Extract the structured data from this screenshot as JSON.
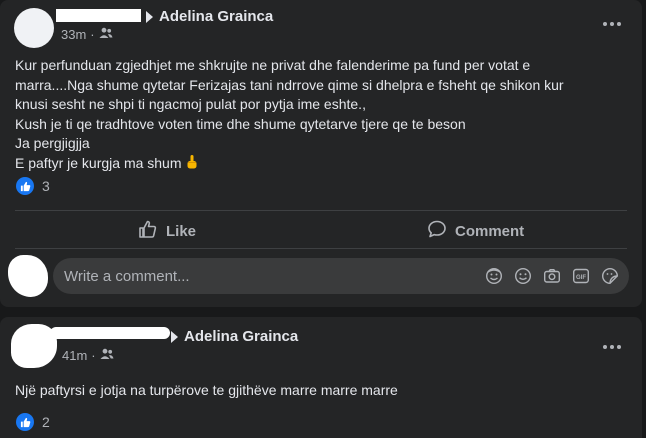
{
  "post1": {
    "author": "Adelina Grainca",
    "time": "33m",
    "text_lines": [
      "Kur perfunduan zgjedhjet me shkrujte ne privat dhe falenderime pa fund per votat e",
      "marra....Nga shume qytetar Ferizajas tani ndrrove qime si dhelpra e fsheht qe shikon kur",
      "knusi sesht ne shpi ti ngacmoj pulat por pytja ime eshte.,",
      "Kush je ti qe tradhtove voten time dhe shume qytetarve tjere qe te beson",
      "Ja pergjigjja",
      "E paftyr je kurgja ma shum"
    ],
    "reaction_count": "3",
    "like_label": "Like",
    "comment_label": "Comment",
    "comment_placeholder": "Write a comment...",
    "comment_icons": [
      "avatar-sticker-icon",
      "emoji-icon",
      "camera-icon",
      "gif-icon",
      "sticker-icon"
    ]
  },
  "post2": {
    "author": "Adelina Graincа",
    "time": "41m",
    "text": "Një paftyrsi e jotja na turpërove te gjithëve marre marre marre",
    "reaction_count": "2"
  },
  "colors": {
    "background": "#18191a",
    "card": "#242526",
    "primary_text": "#e4e6eb",
    "secondary_text": "#b0b3b8",
    "accent": "#1877f2",
    "input_bg": "#3a3b3c"
  }
}
